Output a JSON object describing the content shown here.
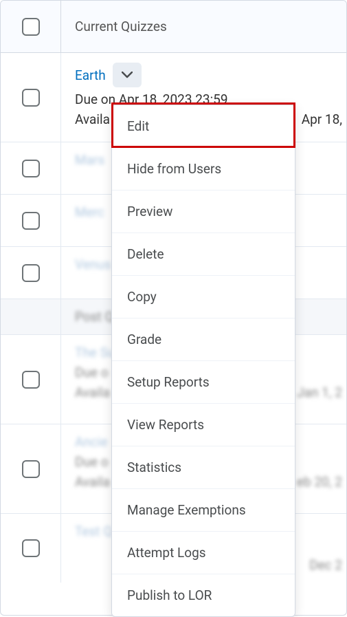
{
  "header": {
    "title": "Current Quizzes"
  },
  "quiz_expanded": {
    "name": "Earth",
    "due": "Due on Apr 18, 2023 23:59",
    "available": "Availa",
    "right_date": "Apr 18, "
  },
  "quizzes_blurred": [
    {
      "name": "Mars"
    },
    {
      "name": "Merc"
    },
    {
      "name": "Venus"
    }
  ],
  "sub_item": {
    "name": "Post Q"
  },
  "quizzes_below": [
    {
      "name": "The Su",
      "due": "Due o",
      "avail": "Availa",
      "right": "Jan 1, 2"
    },
    {
      "name": "Ancie",
      "due": "Due o",
      "avail": "Availa",
      "right": "eb 20, 2"
    },
    {
      "name": "Test Q",
      "due": "",
      "right": "Dec 2"
    }
  ],
  "dropdown": {
    "items": [
      "Edit",
      "Hide from Users",
      "Preview",
      "Delete",
      "Copy",
      "Grade",
      "Setup Reports",
      "View Reports",
      "Statistics",
      "Manage Exemptions",
      "Attempt Logs",
      "Publish to LOR"
    ]
  }
}
